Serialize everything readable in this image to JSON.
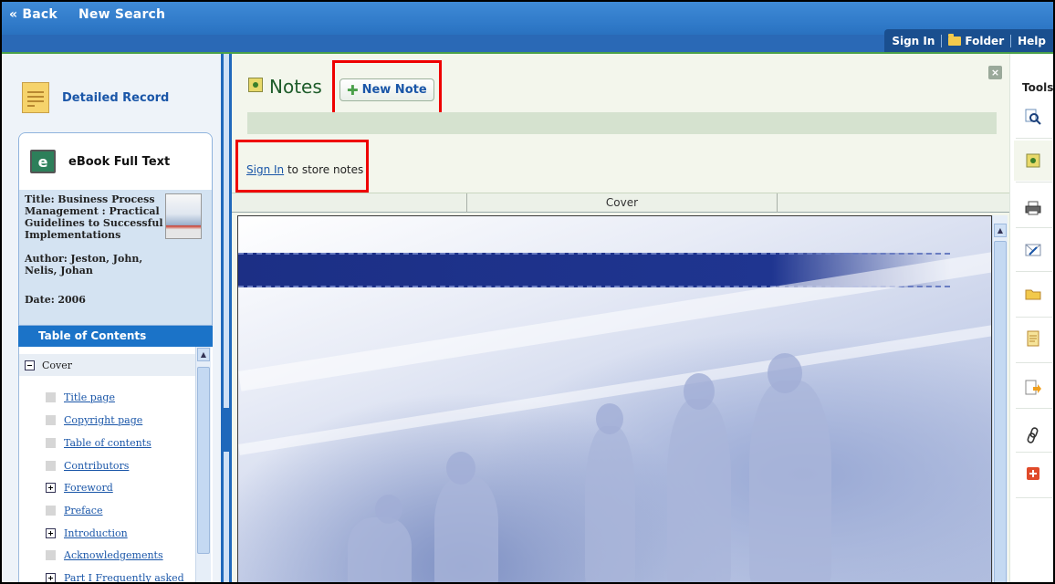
{
  "topbar": {
    "back": "« Back",
    "new_search": "New Search",
    "sign_in": "Sign In",
    "folder": "Folder",
    "help": "Help"
  },
  "sidebar": {
    "detailed_record": "Detailed Record",
    "ebook_full_text": "eBook Full Text",
    "ebook_icon_letter": "e",
    "title_label": "Title:",
    "title_value": "Business Process Management : Practical Guidelines to Successful Implementations",
    "author_label": "Author:",
    "author_value": "Jeston, John, Nelis, Johan",
    "date_label": "Date:",
    "date_value": "2006",
    "toc_header": "Table of Contents",
    "toc_root": "Cover",
    "toc_items": [
      {
        "label": "Title page",
        "expander": "none"
      },
      {
        "label": "Copyright page",
        "expander": "none"
      },
      {
        "label": "Table of contents",
        "expander": "none"
      },
      {
        "label": "Contributors",
        "expander": "none"
      },
      {
        "label": "Foreword",
        "expander": "plus"
      },
      {
        "label": "Preface",
        "expander": "none"
      },
      {
        "label": "Introduction",
        "expander": "plus"
      },
      {
        "label": "Acknowledgements",
        "expander": "none"
      },
      {
        "label": "Part I Frequently asked",
        "expander": "plus"
      }
    ]
  },
  "notes": {
    "title": "Notes",
    "new_note": "New Note",
    "sign_in_link": "Sign In",
    "sign_in_suffix": " to store notes"
  },
  "viewer": {
    "tab_cover": "Cover"
  },
  "tools": {
    "label": "Tools",
    "items": [
      "zoom-icon",
      "notes-icon",
      "print-icon",
      "email-icon",
      "folder-icon",
      "cite-icon",
      "export-icon",
      "link-icon",
      "add-icon"
    ]
  },
  "colors": {
    "topbar": "#2f79c8",
    "highlight": "#ee0000",
    "link": "#1a56a8",
    "notes_bg": "#f3f6ec"
  }
}
